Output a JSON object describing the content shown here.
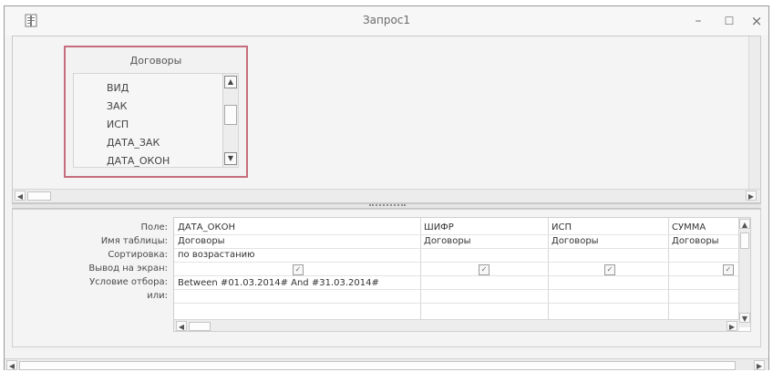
{
  "window": {
    "title": "Запрос1"
  },
  "upper_pane": {
    "table": {
      "title": "Договоры",
      "fields": [
        "ВИД",
        "ЗАК",
        "ИСП",
        "ДАТА_ЗАК",
        "ДАТА_ОКОН"
      ]
    }
  },
  "query_grid": {
    "row_labels": [
      "Поле:",
      "Имя таблицы:",
      "Сортировка:",
      "Вывод на экран:",
      "Условие отбора:",
      "или:"
    ],
    "columns": [
      {
        "field": "ДАТА_ОКОН",
        "table": "Договоры",
        "sort": "по возрастанию",
        "show": true,
        "criteria": "Between #01.03.2014# And #31.03.2014#"
      },
      {
        "field": "ШИФР",
        "table": "Договоры",
        "sort": "",
        "show": true,
        "criteria": ""
      },
      {
        "field": "ИСП",
        "table": "Договоры",
        "sort": "",
        "show": true,
        "criteria": ""
      },
      {
        "field": "СУММА",
        "table": "Договоры",
        "sort": "",
        "show": true,
        "criteria": ""
      }
    ]
  },
  "icons": {
    "window_icon": "query-window-icon",
    "minimize": "minimize-icon",
    "maximize": "maximize-icon",
    "close": "close-icon"
  }
}
